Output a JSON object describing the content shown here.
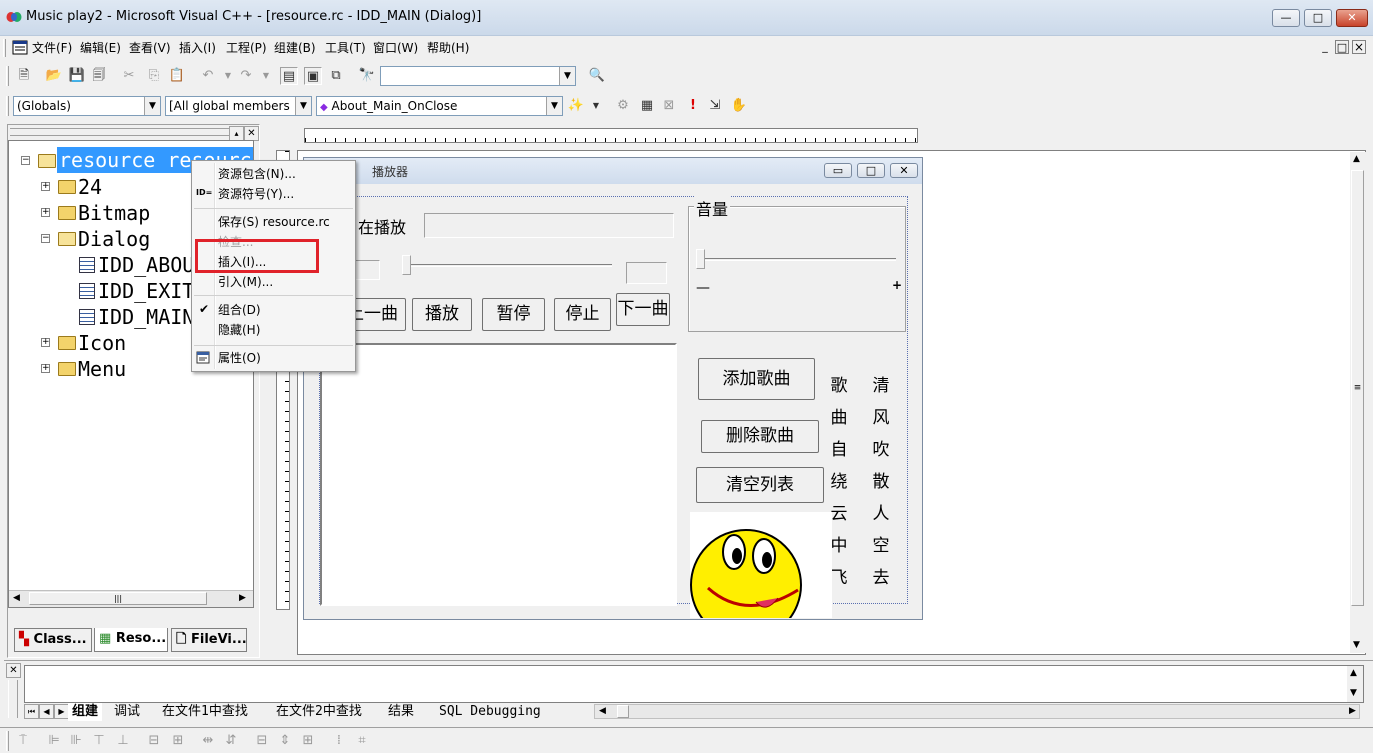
{
  "window": {
    "title": "Music play2 - Microsoft Visual C++ - [resource.rc - IDD_MAIN (Dialog)]",
    "controls": {
      "minimize": "—",
      "maximize": "□",
      "close": "✕"
    }
  },
  "menubar": {
    "items": [
      "文件(F)",
      "编辑(E)",
      "查看(V)",
      "插入(I)",
      "工程(P)",
      "组建(B)",
      "工具(T)",
      "窗口(W)",
      "帮助(H)"
    ],
    "mdi_controls": [
      "_",
      "□",
      "×"
    ]
  },
  "toolbar": {
    "find_combo_value": "",
    "icons": [
      "new-text-icon",
      "open-icon",
      "save-icon",
      "save-all-icon",
      "cut-icon",
      "copy-icon",
      "paste-icon",
      "undo-icon",
      "redo-icon",
      "workspace-icon",
      "output-icon",
      "window-list-icon",
      "find-in-files-icon",
      "find-icon"
    ]
  },
  "wizardbar": {
    "class_combo": "(Globals)",
    "filter_combo": "[All global members",
    "member_combo": "About_Main_OnClose"
  },
  "workspace": {
    "tree": {
      "root": "resource resource",
      "items": [
        {
          "label": "24",
          "type": "folder",
          "expanded": false
        },
        {
          "label": "Bitmap",
          "type": "folder",
          "expanded": false
        },
        {
          "label": "Dialog",
          "type": "folder",
          "expanded": true
        },
        {
          "label": "IDD_ABOUT",
          "type": "dialog"
        },
        {
          "label": "IDD_EXIT",
          "type": "dialog"
        },
        {
          "label": "IDD_MAIN",
          "type": "dialog"
        },
        {
          "label": "Icon",
          "type": "folder",
          "expanded": false
        },
        {
          "label": "Menu",
          "type": "folder",
          "expanded": false
        }
      ]
    },
    "tabs": [
      "Class...",
      "Reso...",
      "FileVi..."
    ]
  },
  "context_menu": {
    "items": [
      {
        "label": "资源包含(N)...",
        "icon": "",
        "enabled": true
      },
      {
        "label": "资源符号(Y)...",
        "icon": "ID=",
        "enabled": true
      },
      {
        "label": "保存(S) resource.rc",
        "icon": "",
        "enabled": true
      },
      {
        "label": "检查...",
        "icon": "",
        "enabled": false
      },
      {
        "label": "插入(I)...",
        "icon": "",
        "enabled": true,
        "highlighted": true
      },
      {
        "label": "引入(M)...",
        "icon": "",
        "enabled": true
      },
      {
        "label": "组合(D)",
        "icon": "✔",
        "enabled": true,
        "checked": true
      },
      {
        "label": "隐藏(H)",
        "icon": "",
        "enabled": true
      },
      {
        "label": "属性(O)",
        "icon": "properties-icon",
        "enabled": true
      }
    ],
    "highlight_color": "#e0222a"
  },
  "dialog_preview": {
    "caption": "播放器",
    "now_playing_label": "在播放",
    "volume_group": "音量",
    "volume_min": "—",
    "volume_max": "+",
    "buttons": {
      "prev": "上一曲",
      "play": "播放",
      "pause": "暂停",
      "stop": "停止",
      "next": "下一曲",
      "add": "添加歌曲",
      "delete": "删除歌曲",
      "clear": "清空列表"
    },
    "poem_col1": [
      "歌",
      "曲",
      "自",
      "绕",
      "云",
      "中",
      "飞"
    ],
    "poem_col2": [
      "清",
      "风",
      "吹",
      "散",
      "人",
      "空",
      "去"
    ]
  },
  "output": {
    "tabs": [
      "组建",
      "调试",
      "在文件1中查找",
      "在文件2中查找",
      "结果",
      "SQL Debugging"
    ]
  }
}
